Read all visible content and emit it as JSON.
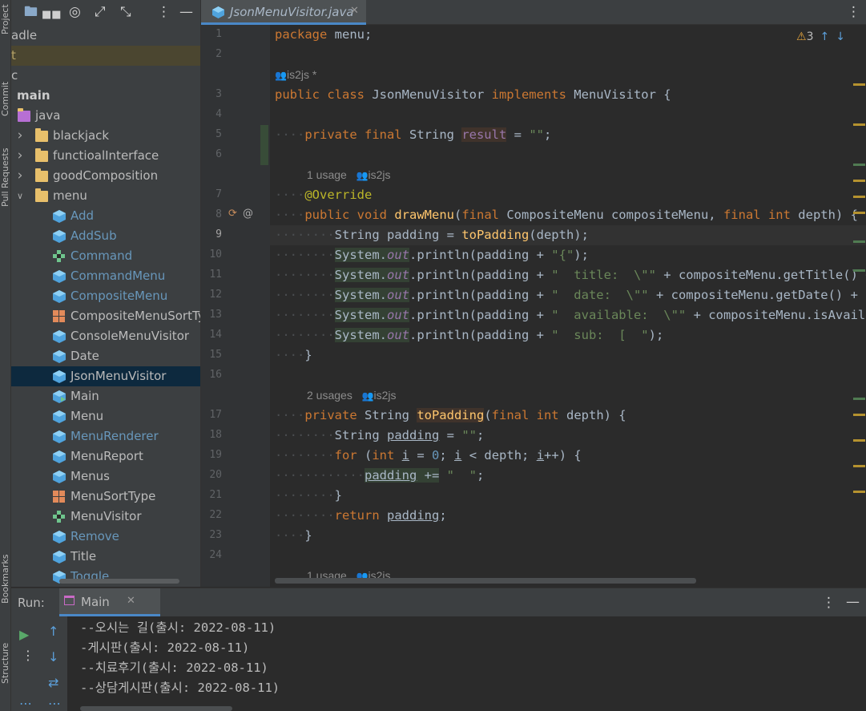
{
  "stripe": {
    "project": "Project",
    "commit": "Commit",
    "pull_requests": "Pull Requests",
    "bookmarks": "Bookmarks",
    "structure": "Structure"
  },
  "project_panel": {
    "toolbar_icons": [
      "folder-icon",
      "target-icon",
      "expand-icon",
      "collapse-icon",
      "more-icon",
      "minimize-icon"
    ],
    "top_fragments": [
      "adle",
      "t",
      "c"
    ],
    "items": [
      {
        "label": "main",
        "type": "module"
      },
      {
        "label": "java",
        "type": "source-folder"
      },
      {
        "label": "blackjack",
        "type": "package",
        "expanded": false
      },
      {
        "label": "functioalInterface",
        "type": "package",
        "expanded": false
      },
      {
        "label": "goodComposition",
        "type": "package",
        "expanded": false
      },
      {
        "label": "menu",
        "type": "package",
        "expanded": true
      },
      {
        "label": "Add",
        "type": "class"
      },
      {
        "label": "AddSub",
        "type": "class"
      },
      {
        "label": "Command",
        "type": "interface"
      },
      {
        "label": "CommandMenu",
        "type": "class"
      },
      {
        "label": "CompositeMenu",
        "type": "class"
      },
      {
        "label": "CompositeMenuSortType",
        "type": "enum"
      },
      {
        "label": "ConsoleMenuVisitor",
        "type": "class"
      },
      {
        "label": "Date",
        "type": "class"
      },
      {
        "label": "JsonMenuVisitor",
        "type": "class",
        "selected": true
      },
      {
        "label": "Main",
        "type": "main-class"
      },
      {
        "label": "Menu",
        "type": "class"
      },
      {
        "label": "MenuRenderer",
        "type": "class"
      },
      {
        "label": "MenuReport",
        "type": "class"
      },
      {
        "label": "Menus",
        "type": "class"
      },
      {
        "label": "MenuSortType",
        "type": "enum"
      },
      {
        "label": "MenuVisitor",
        "type": "interface"
      },
      {
        "label": "Remove",
        "type": "class"
      },
      {
        "label": "Title",
        "type": "class"
      },
      {
        "label": "Toggle",
        "type": "class"
      }
    ]
  },
  "editor": {
    "tab_label": "JsonMenuVisitor.java",
    "warnings_count": "3",
    "colors": {
      "keyword": "#cc7832",
      "function": "#ffc66d",
      "string": "#6a8759",
      "number": "#6897bb",
      "annotation": "#bbb529",
      "static_field": "#9876aa"
    },
    "hints": {
      "h1_author": "is2js *",
      "h2_usage": "1 usage",
      "h2_author": "is2js",
      "h3_usage": "2 usages",
      "h3_author": "is2js",
      "h4_usage": "1 usage",
      "h4_author": "is2js"
    },
    "line_numbers": [
      "1",
      "2",
      "3",
      "4",
      "5",
      "6",
      "7",
      "8",
      "9",
      "10",
      "11",
      "12",
      "13",
      "14",
      "15",
      "16",
      "17",
      "18",
      "19",
      "20",
      "21",
      "22",
      "23",
      "24"
    ]
  },
  "run_panel": {
    "title": "Run:",
    "tab_label": "Main",
    "output": [
      "--오시는 길(출시: 2022-08-11)",
      "-게시판(출시: 2022-08-11)",
      "--치료후기(출시: 2022-08-11)",
      "--상담게시판(출시: 2022-08-11)"
    ]
  }
}
